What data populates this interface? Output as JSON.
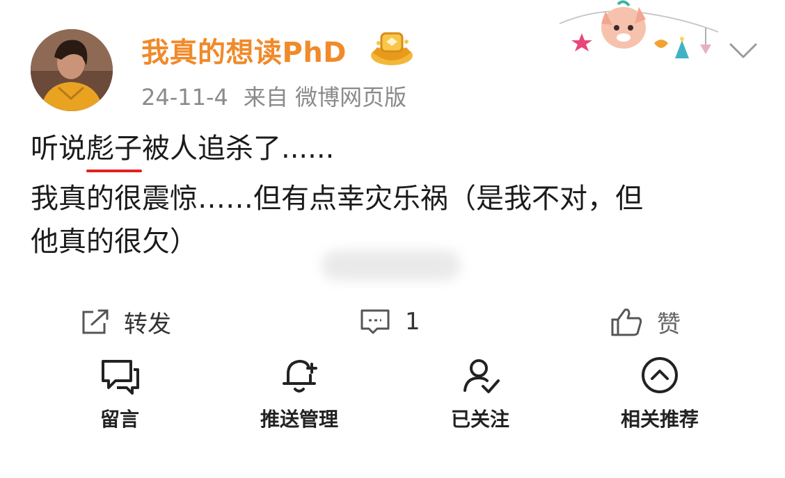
{
  "post": {
    "username": "我真的想读PhD",
    "date": "24-11-4",
    "source": "来自 微博网页版",
    "text": {
      "line1_before": "听说",
      "line1_highlight": "彪子",
      "line1_after": "被人追杀了......",
      "line2": "我真的很震惊……但有点幸灾乐祸（是我不对，但",
      "line3": "他真的很欠）"
    }
  },
  "actions": {
    "repost_label": "转发",
    "comment_count": "1",
    "like_label": "赞"
  },
  "menu": {
    "leave_message": "留言",
    "push_manage": "推送管理",
    "followed": "已关注",
    "related": "相关推荐"
  },
  "colors": {
    "username": "#f08a2a",
    "underline": "#e32020",
    "meta": "#8a8a8a"
  },
  "icons": [
    "vip-gold-icon",
    "chevron-down-icon",
    "repost-icon",
    "comment-icon",
    "like-icon",
    "message-icon",
    "bell-icon",
    "user-check-icon",
    "chevron-up-circle-icon"
  ]
}
